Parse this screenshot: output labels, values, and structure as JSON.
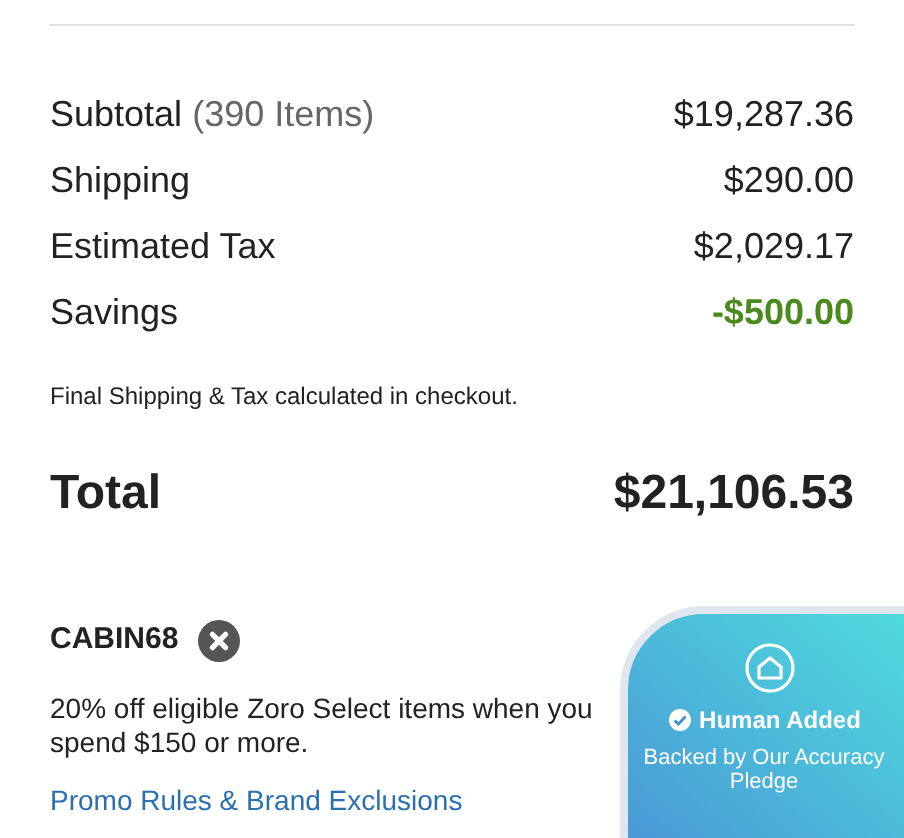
{
  "summary": [
    {
      "label": "Subtotal",
      "detail": "(390 Items)",
      "value": "$19,287.36",
      "kind": "normal"
    },
    {
      "label": "Shipping",
      "value": "$290.00",
      "kind": "normal"
    },
    {
      "label": "Estimated Tax",
      "value": "$2,029.17",
      "kind": "normal"
    },
    {
      "label": "Savings",
      "value": "-$500.00",
      "kind": "discount"
    }
  ],
  "note": "Final Shipping & Tax calculated in checkout.",
  "total": {
    "label": "Total",
    "value": "$21,106.53"
  },
  "promo": {
    "code": "CABIN68",
    "description": "20% off eligible Zoro Select items when you spend $150 or more.",
    "link": "Promo Rules & Brand Exclusions"
  },
  "badge": {
    "title": "Human Added",
    "subtitle": "Backed by Our Accuracy Pledge"
  }
}
